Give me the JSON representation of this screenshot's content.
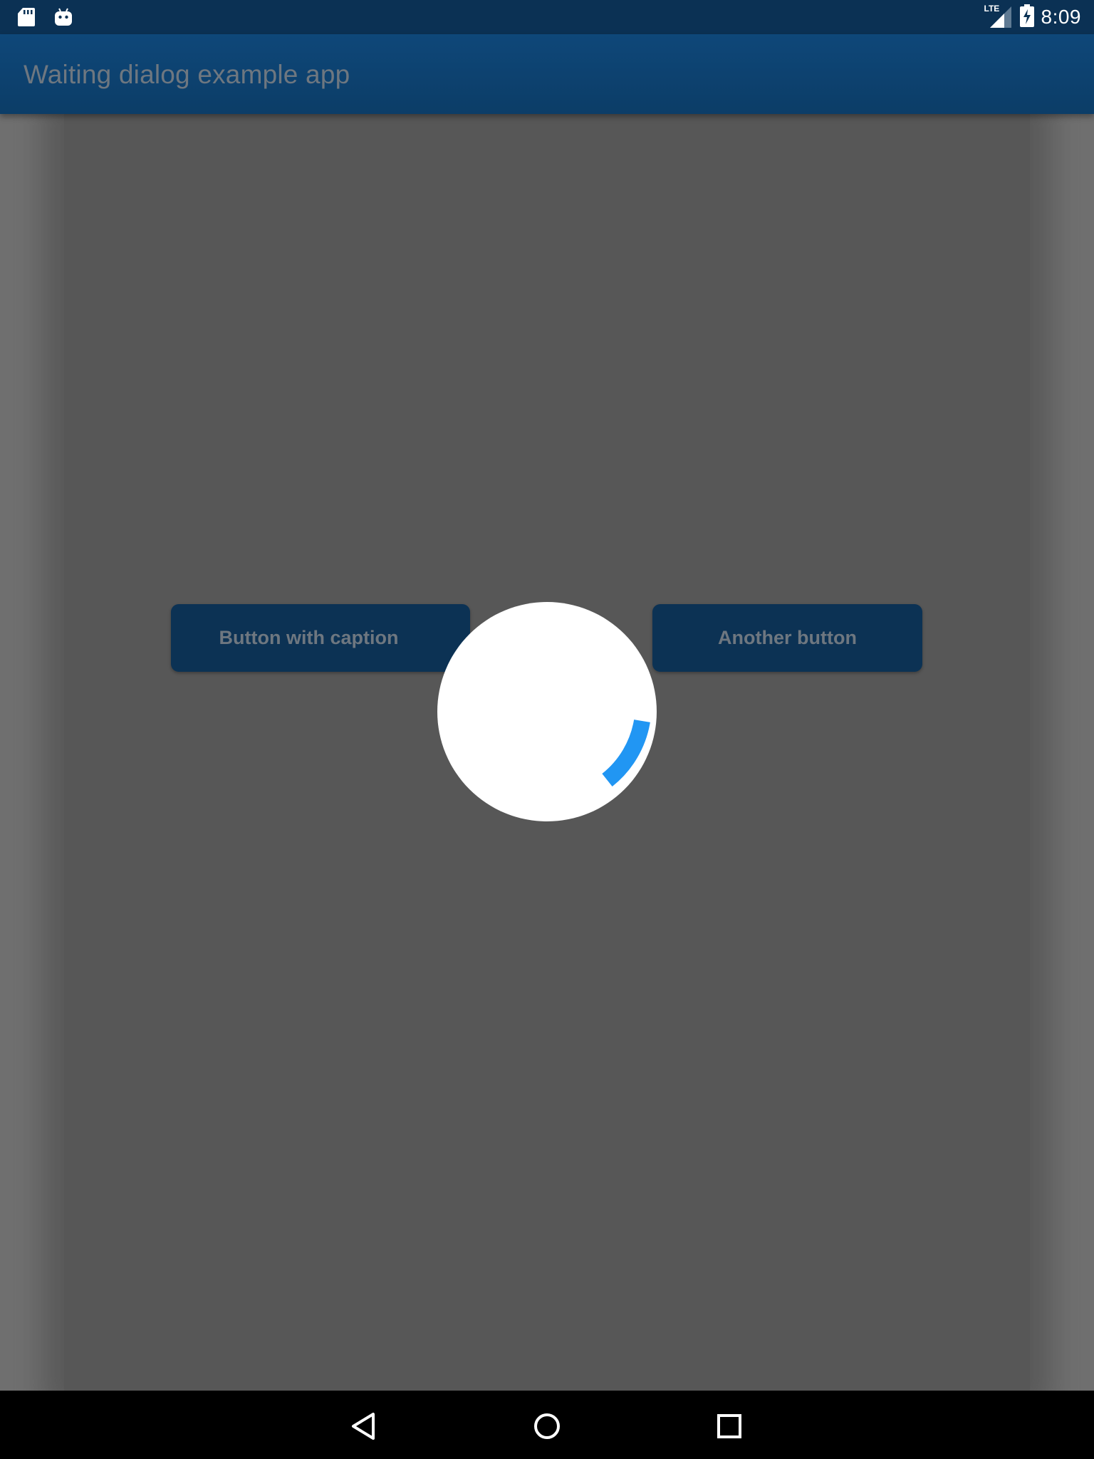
{
  "status_bar": {
    "left_icons": [
      "sd-card-icon",
      "android-icon"
    ],
    "network_label": "LTE",
    "time": "8:09"
  },
  "app_bar": {
    "title": "Waiting dialog example app"
  },
  "buttons": {
    "button_with_caption": "Button with caption",
    "another_button": "Another button"
  },
  "waiting_dialog": {
    "indicator": "circular-progress-indicator",
    "accent_color": "#2196f3"
  },
  "nav_bar": {
    "icons": [
      "back-icon",
      "home-icon",
      "recent-apps-icon"
    ]
  },
  "colors": {
    "status_bar": "#0b3154",
    "app_bar": "#0e4779",
    "button": "#0c3254",
    "overlay_panel": "#575757",
    "spinner_arc": "#2196f3"
  }
}
